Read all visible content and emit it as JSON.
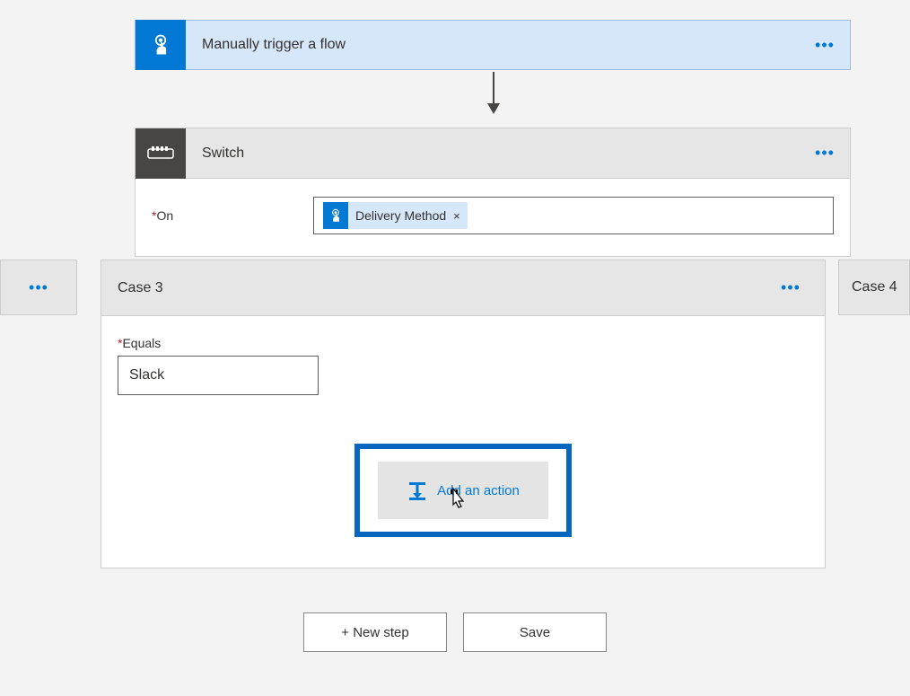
{
  "trigger": {
    "title": "Manually trigger a flow"
  },
  "switch": {
    "title": "Switch",
    "on_label": "On",
    "token": {
      "label": "Delivery Method"
    }
  },
  "case": {
    "title": "Case 3",
    "equals_label": "Equals",
    "equals_value": "Slack",
    "add_action_label": "Add an action"
  },
  "next_case": {
    "title": "Case 4"
  },
  "footer": {
    "new_step": "+ New step",
    "save": "Save"
  }
}
